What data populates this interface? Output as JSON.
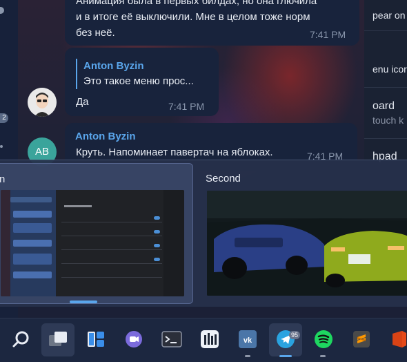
{
  "chat": {
    "messages": [
      {
        "lines": [
          "Анимация была в первых билдах, но она глючила",
          "и в итоге её выключили. Мне в целом тоже норм",
          "без неё."
        ],
        "time": "7:41 PM"
      },
      {
        "reply_sender": "Anton Byzin",
        "reply_preview": "Это такое меню прос...",
        "text": "Да",
        "time": "7:41 PM"
      },
      {
        "sender": "Anton Byzin",
        "avatar_initials": "AB",
        "text": "Круть. Напоминает павертач на яблоках.",
        "time": "7:41 PM"
      }
    ],
    "left_badge": "2"
  },
  "right_panel": {
    "items": [
      {
        "label": "pear on",
        "sub": ""
      },
      {
        "label": "enu icor",
        "sub": ""
      },
      {
        "label": "oard",
        "sub": "touch k"
      },
      {
        "label": "hpad",
        "sub": ""
      }
    ]
  },
  "snap_groups": {
    "first_title": "n",
    "second_title": "Second"
  },
  "taskbar": {
    "telegram_badge": "95",
    "apps": [
      "search-icon",
      "task-view-icon",
      "widgets-icon",
      "teams-icon",
      "terminal-icon",
      "app-icon",
      "vk-icon",
      "telegram-icon",
      "spotify-icon",
      "sublime-icon",
      "office-icon"
    ]
  },
  "colors": {
    "accent": "#5aa6ec",
    "bubble": "#18233c",
    "taskbar": "#1c2740"
  }
}
